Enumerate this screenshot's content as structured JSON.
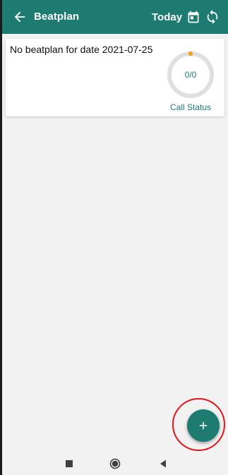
{
  "app_bar": {
    "title": "Beatplan",
    "today_label": "Today",
    "back_icon": "arrow-left-icon",
    "calendar_icon": "calendar-icon",
    "sync_icon": "sync-icon",
    "background_color": "#1e7b72"
  },
  "beatplan_card": {
    "message": "No beatplan for date 2021-07-25",
    "progress_text": "0/0",
    "status_label": "Call Status",
    "ring_color": "#e0e0e0",
    "indicator_color": "#f4a21b"
  },
  "fab": {
    "icon": "plus-icon",
    "highlight_color": "#e3141b"
  },
  "system_nav": {
    "recents_icon": "square-icon",
    "home_icon": "circle-icon",
    "back_icon": "triangle-back-icon"
  }
}
